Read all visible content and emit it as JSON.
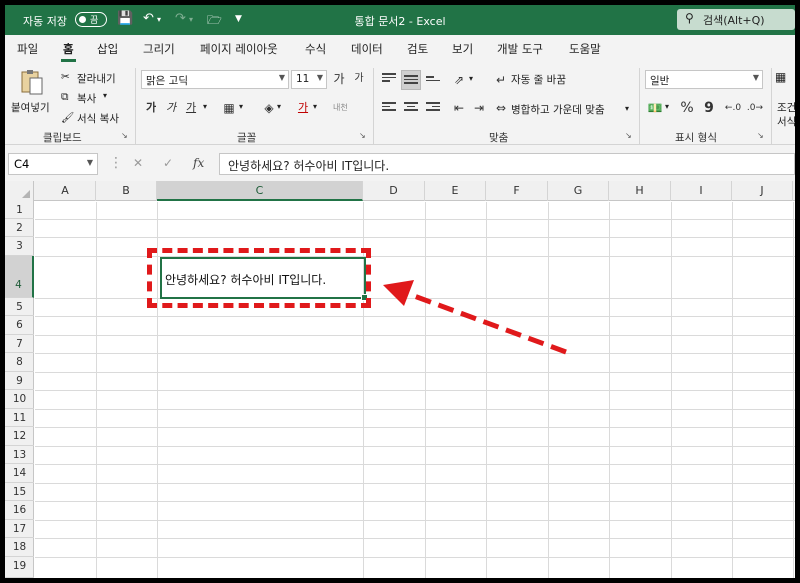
{
  "titlebar": {
    "autosave_label": "자동 저장",
    "autosave_state": "끔",
    "doc_title": "통합 문서2 - Excel",
    "search_placeholder": "검색(Alt+Q)"
  },
  "menu_tabs": [
    "파일",
    "홈",
    "삽입",
    "그리기",
    "페이지 레이아웃",
    "수식",
    "데이터",
    "검토",
    "보기",
    "개발 도구",
    "도움말"
  ],
  "active_tab": "홈",
  "ribbon": {
    "clipboard": {
      "paste": "붙여넣기",
      "cut": "잘라내기",
      "copy": "복사",
      "format_painter": "서식 복사",
      "label": "클립보드"
    },
    "font": {
      "font_name": "맑은 고딕",
      "font_size": "11",
      "grow": "가",
      "shrink": "가",
      "bold": "가",
      "italic": "가",
      "underline": "가",
      "font_color": "가",
      "phonetic": "내천",
      "label": "글꼴"
    },
    "alignment": {
      "wrap_text": "자동 줄 바꿈",
      "merge_center": "병합하고 가운데 맞춤",
      "label": "맞춤"
    },
    "number": {
      "format": "일반",
      "percent": "%",
      "comma": "9",
      "label": "표시 형식"
    },
    "styles": {
      "conditional": "조건부",
      "format": "서식"
    }
  },
  "formula_bar": {
    "name_box": "C4",
    "cancel": "✕",
    "enter": "✓",
    "fx": "fx",
    "content": "안녕하세요? 허수아비 IT입니다."
  },
  "grid": {
    "columns": [
      "A",
      "B",
      "C",
      "D",
      "E",
      "F",
      "G",
      "H",
      "I",
      "J"
    ],
    "active_column": "C",
    "rows": [
      "1",
      "2",
      "3",
      "4",
      "5",
      "6",
      "7",
      "8",
      "9",
      "10",
      "11",
      "12",
      "13",
      "14",
      "15",
      "16",
      "17",
      "18",
      "19"
    ],
    "active_row": "4",
    "active_cell_value": "안녕하세요? 허수아비 IT입니다."
  },
  "colors": {
    "accent": "#217346",
    "annotation": "#e0191b"
  }
}
